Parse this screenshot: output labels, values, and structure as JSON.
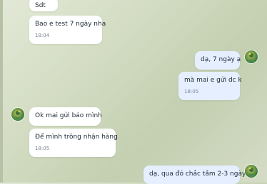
{
  "messages": [
    {
      "text": "Sdt",
      "time": ""
    },
    {
      "text": "Bao e test 7 ngày nha",
      "time": "18:04"
    },
    {
      "text": "dạ, 7 ngày ạ",
      "time": ""
    },
    {
      "text": "mà mai e gửi dc k",
      "time": "18:05"
    },
    {
      "text": "Ok mai gửi báo mình",
      "time": ""
    },
    {
      "text": "Để mình trông nhận hàng",
      "time": "18:05"
    },
    {
      "text": "dạ, qua đó chắc tầm 2-3 ngày",
      "time": ""
    }
  ],
  "avatars": {
    "self": "avatar-self",
    "contact": "avatar-contact"
  },
  "colors": {
    "incoming_bubble": "#ffffff",
    "outgoing_bubble": "#e5efff",
    "background": "#d3dcc2"
  }
}
